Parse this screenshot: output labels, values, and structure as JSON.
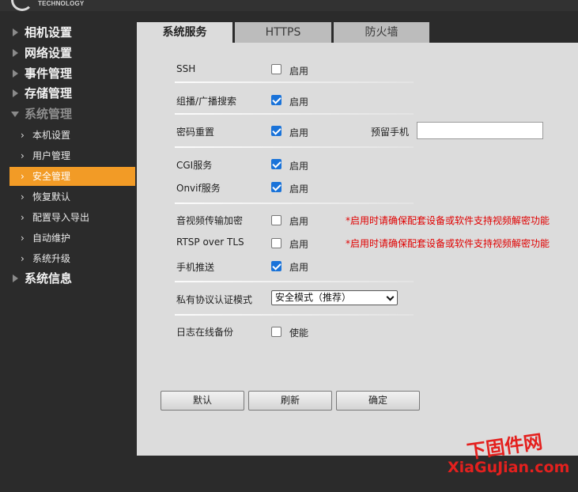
{
  "brand": {
    "logo_text": "TECHNOLOGY"
  },
  "sidebar": {
    "items": [
      {
        "label": "相机设置"
      },
      {
        "label": "网络设置"
      },
      {
        "label": "事件管理"
      },
      {
        "label": "存储管理"
      },
      {
        "label": "系统管理"
      },
      {
        "label": "系统信息"
      }
    ],
    "sub_items": [
      {
        "label": "本机设置"
      },
      {
        "label": "用户管理"
      },
      {
        "label": "安全管理",
        "active": true
      },
      {
        "label": "恢复默认"
      },
      {
        "label": "配置导入导出"
      },
      {
        "label": "自动维护"
      },
      {
        "label": "系统升级"
      }
    ]
  },
  "tabs": [
    {
      "label": "系统服务",
      "active": true
    },
    {
      "label": "HTTPS"
    },
    {
      "label": "防火墙"
    }
  ],
  "settings": {
    "ssh": {
      "label": "SSH",
      "checked": false,
      "option": "启用"
    },
    "multicast": {
      "label": "组播/广播搜索",
      "checked": true,
      "option": "启用"
    },
    "password_reset": {
      "label": "密码重置",
      "checked": true,
      "option": "启用"
    },
    "reserved_phone": {
      "label": "预留手机",
      "value": ""
    },
    "cgi": {
      "label": "CGI服务",
      "checked": true,
      "option": "启用"
    },
    "onvif": {
      "label": "Onvif服务",
      "checked": true,
      "option": "启用"
    },
    "av_encrypt": {
      "label": "音视频传输加密",
      "checked": false,
      "option": "启用",
      "warning": "*启用时请确保配套设备或软件支持视频解密功能"
    },
    "rtsp_tls": {
      "label": "RTSP over TLS",
      "checked": false,
      "option": "启用",
      "warning": "*启用时请确保配套设备或软件支持视频解密功能"
    },
    "mobile_push": {
      "label": "手机推送",
      "checked": true,
      "option": "启用"
    },
    "private_auth": {
      "label": "私有协议认证模式",
      "selected": "安全模式（推荐）"
    },
    "log_backup": {
      "label": "日志在线备份",
      "checked": false,
      "option": "使能"
    }
  },
  "buttons": {
    "default": "默认",
    "refresh": "刷新",
    "confirm": "确定"
  },
  "watermark": {
    "line1": "下固件网",
    "line2": "XiaGuJian.com"
  },
  "colors": {
    "accent": "#f29b26",
    "checkbox": "#1a73d9",
    "warning": "#e00000"
  }
}
